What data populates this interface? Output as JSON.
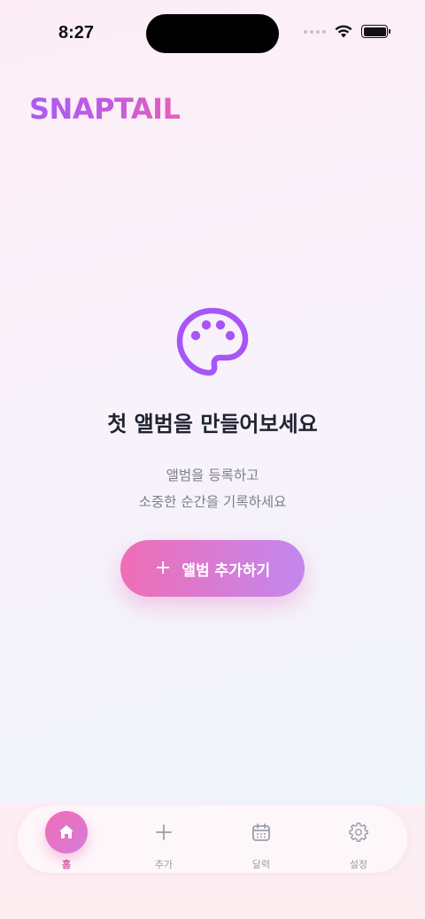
{
  "status_bar": {
    "time": "8:27"
  },
  "header": {
    "logo": "SNAPTAIL"
  },
  "empty_state": {
    "icon": "palette-icon",
    "title": "첫 앨범을 만들어보세요",
    "description_line1": "앨범을 등록하고",
    "description_line2": "소중한 순간을 기록하세요"
  },
  "add_button": {
    "icon": "plus-icon",
    "label": "앨범 추가하기"
  },
  "tab_bar": {
    "items": [
      {
        "label": "홈",
        "icon": "home-icon",
        "active": true
      },
      {
        "label": "추가",
        "icon": "plus-icon"
      },
      {
        "label": "달력",
        "icon": "calendar-icon"
      },
      {
        "label": "설정",
        "icon": "gear-icon"
      }
    ]
  },
  "colors": {
    "accent_pink": "#ef6eb5",
    "accent_purple": "#a95cf2",
    "icon_purple": "#a855f7"
  }
}
